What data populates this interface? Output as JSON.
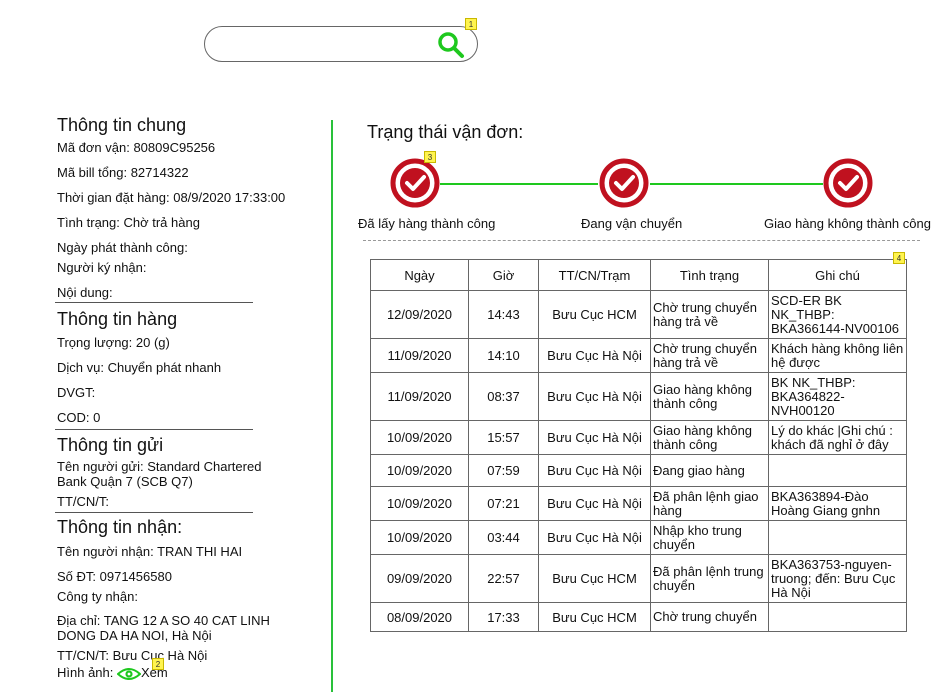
{
  "search": {
    "value": "",
    "placeholder": ""
  },
  "markers": [
    "1",
    "2",
    "3",
    "4"
  ],
  "general": {
    "title": "Thông tin chung",
    "order_code": "Mã đơn vận:  80809C95256",
    "bill_total": "Mã bill tổng: 82714322",
    "order_time": "Thời gian đặt hàng:  08/9/2020 17:33:00",
    "status": "Tình trạng: Chờ trả hàng",
    "delivered_date": "Ngày phát thành công:",
    "signer": "Người ký nhận:",
    "content": "Nội dung:"
  },
  "goods": {
    "title": "Thông tin hàng",
    "weight": "Trọng lượng: 20 (g)",
    "service": "Dịch vụ: Chuyển phát nhanh",
    "dvgt": "DVGT:",
    "cod": "COD: 0"
  },
  "sender": {
    "title": "Thông tin gửi",
    "name": "Tên người gửi: Standard Chartered Bank Quận 7 (SCB Q7)",
    "office": "TT/CN/T:"
  },
  "receiver": {
    "title": "Thông tin nhận:",
    "name": "Tên người nhận: TRAN THI HAI",
    "phone": "Số ĐT: 0971456580",
    "company": "Công ty nhận:",
    "address": "Địa chỉ: TANG 12 A SO 40 CAT LINH DONG DA HA NOI, Hà Nội",
    "office": "TT/CN/T: Bưu Cục Hà Nội",
    "image_label": "Hình ảnh:",
    "view_link": "Xem"
  },
  "status": {
    "title": "Trạng thái vận đơn:",
    "steps": [
      "Đã lấy hàng thành công",
      "Đang vận chuyển",
      "Giao hàng không thành công"
    ]
  },
  "colors": {
    "accent_red": "#c0111f",
    "accent_green": "#1ec81e"
  },
  "table": {
    "headers": [
      "Ngày",
      "Giờ",
      "TT/CN/Trạm",
      "Tình trạng",
      "Ghi chú"
    ],
    "rows": [
      [
        "12/09/2020",
        "14:43",
        "Bưu Cục HCM",
        "Chờ trung chuyển hàng trả về",
        "SCD-ER BK NK_THBP: BKA366144-NV00106"
      ],
      [
        "11/09/2020",
        "14:10",
        "Bưu Cục Hà Nội",
        "Chờ trung chuyển hàng trả về",
        "Khách hàng không liên hệ được"
      ],
      [
        "11/09/2020",
        "08:37",
        "Bưu Cục Hà Nội",
        "Giao hàng không thành công",
        "BK NK_THBP: BKA364822-NVH00120"
      ],
      [
        "10/09/2020",
        "15:57",
        "Bưu Cục Hà Nội",
        "Giao hàng không thành công",
        "Lý do khác |Ghi chú : khách đã nghỉ ở đây"
      ],
      [
        "10/09/2020",
        "07:59",
        "Bưu Cục Hà Nội",
        "Đang giao hàng",
        ""
      ],
      [
        "10/09/2020",
        "07:21",
        "Bưu Cục Hà Nội",
        "Đã phân lệnh giao hàng",
        "BKA363894-Đào Hoàng Giang gnhn"
      ],
      [
        "10/09/2020",
        "03:44",
        "Bưu Cục Hà Nội",
        "Nhập kho trung chuyển",
        ""
      ],
      [
        "09/09/2020",
        "22:57",
        "Bưu Cục HCM",
        "Đã phân lệnh trung chuyển",
        "BKA363753-nguyen-truong; đến: Bưu Cục Hà Nội"
      ],
      [
        "08/09/2020",
        "17:33",
        "Bưu Cục HCM",
        "Chờ trung chuyển",
        ""
      ]
    ]
  }
}
